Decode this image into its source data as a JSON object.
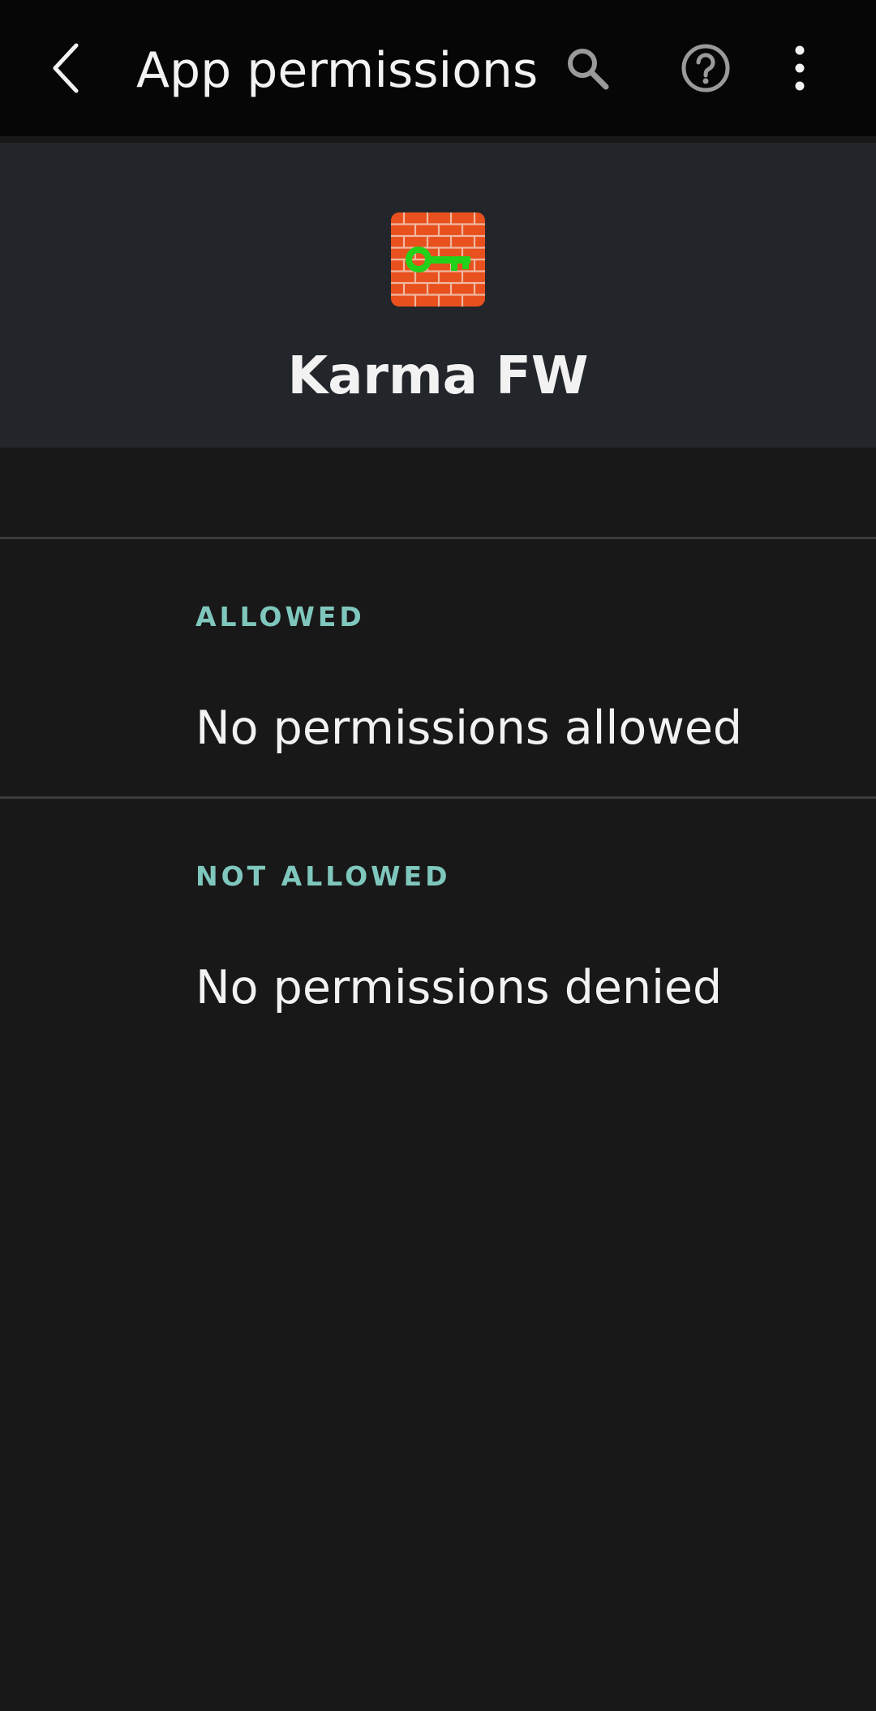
{
  "topbar": {
    "title": "App permissions",
    "back_icon": "chevron-left-icon",
    "search_icon": "search-icon",
    "help_icon": "help-circle-icon",
    "more_icon": "more-vert-icon"
  },
  "app": {
    "name": "Karma FW",
    "icon": "firewall-key-icon"
  },
  "sections": {
    "allowed": {
      "header": "ALLOWED",
      "empty_text": "No permissions allowed"
    },
    "not_allowed": {
      "header": "NOT ALLOWED",
      "empty_text": "No permissions denied"
    }
  },
  "colors": {
    "accent": "#7fc7bd",
    "background": "#181818",
    "topbar": "#060606",
    "header_bg": "#22262b",
    "brick": "#e8501e",
    "key": "#22d11a"
  }
}
